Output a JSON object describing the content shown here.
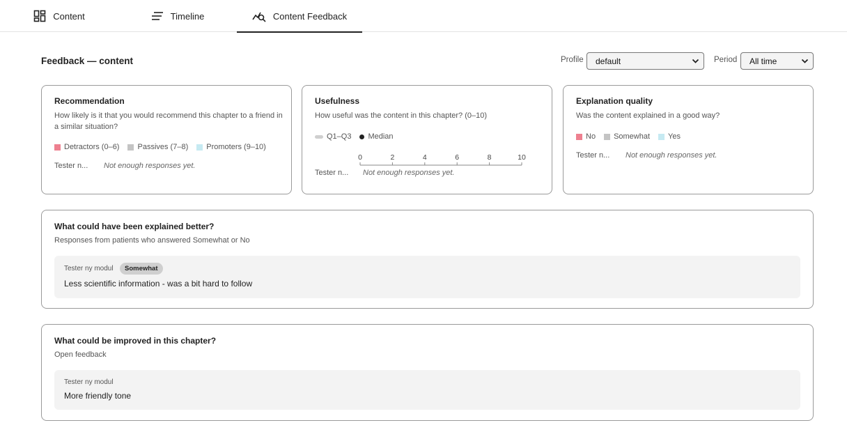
{
  "tabs": [
    {
      "label": "Content",
      "icon": "dashboard-icon",
      "active": false
    },
    {
      "label": "Timeline",
      "icon": "lines-icon",
      "active": false
    },
    {
      "label": "Content Feedback",
      "icon": "chart-search-icon",
      "active": true
    }
  ],
  "header": {
    "title": "Feedback — content",
    "profile_label": "Profile",
    "profile_value": "default",
    "period_label": "Period",
    "period_value": "All time"
  },
  "cards": {
    "recommendation": {
      "title": "Recommendation",
      "subtitle": "How likely is it that you would recommend this chapter to a friend in a similar situation?",
      "legend": [
        "Detractors (0–6)",
        "Passives (7–8)",
        "Promoters (9–10)"
      ],
      "row_label": "Tester n...",
      "empty": "Not enough responses yet."
    },
    "usefulness": {
      "title": "Usefulness",
      "subtitle": "How useful was the content in this chapter? (0–10)",
      "legend": [
        "Q1–Q3",
        "Median"
      ],
      "ticks": [
        "0",
        "2",
        "4",
        "6",
        "8",
        "10"
      ],
      "row_label": "Tester n...",
      "empty": "Not enough responses yet."
    },
    "explanation": {
      "title": "Explanation quality",
      "subtitle": "Was the content explained in a good way?",
      "legend": [
        "No",
        "Somewhat",
        "Yes"
      ],
      "row_label": "Tester n...",
      "empty": "Not enough responses yet."
    }
  },
  "explained_better": {
    "title": "What could have been explained better?",
    "subtitle": "Responses from patients who answered Somewhat or No",
    "responses": [
      {
        "author": "Tester ny modul",
        "badge": "Somewhat",
        "text": "Less scientific information - was a bit hard to follow"
      }
    ]
  },
  "improved": {
    "title": "What could be improved in this chapter?",
    "subtitle": "Open feedback",
    "responses": [
      {
        "author": "Tester ny modul",
        "text": "More friendly tone"
      }
    ]
  },
  "colors": {
    "detractors": "#ee8090",
    "passives": "#c4c4c4",
    "promoters": "#c6eaf2",
    "text": "#222222",
    "border": "#9a9a9a"
  }
}
